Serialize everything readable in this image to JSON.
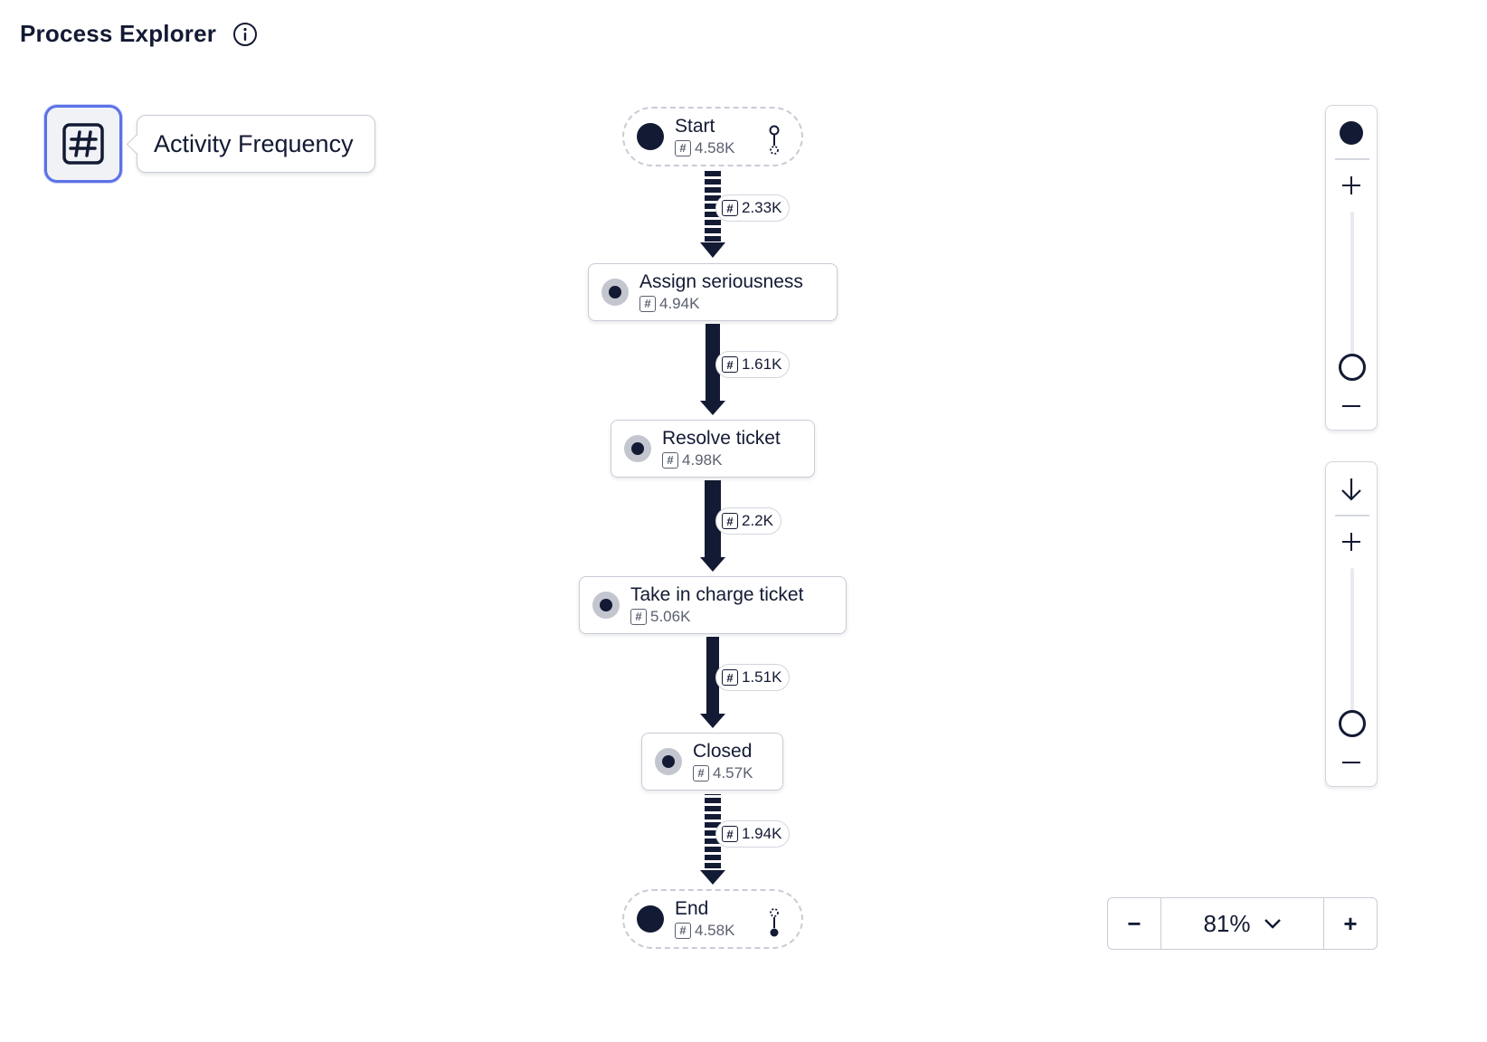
{
  "header": {
    "title": "Process Explorer",
    "info_icon": "info-icon"
  },
  "metric": {
    "icon": "hash-icon",
    "label": "Activity Frequency"
  },
  "nodes": {
    "start": {
      "label": "Start",
      "count": "4.58K"
    },
    "assign": {
      "label": "Assign seriousness",
      "count": "4.94K"
    },
    "resolve": {
      "label": "Resolve ticket",
      "count": "4.98K"
    },
    "take": {
      "label": "Take in charge ticket",
      "count": "5.06K"
    },
    "closed": {
      "label": "Closed",
      "count": "4.57K"
    },
    "end": {
      "label": "End",
      "count": "4.58K"
    }
  },
  "edges": {
    "e1": {
      "count": "2.33K",
      "style": "dashed"
    },
    "e2": {
      "count": "1.61K",
      "style": "solid"
    },
    "e3": {
      "count": "2.2K",
      "style": "solid"
    },
    "e4": {
      "count": "1.51K",
      "style": "solid"
    },
    "e5": {
      "count": "1.94K",
      "style": "dashed"
    }
  },
  "sliders": {
    "activities": {
      "icon": "node-dot-icon",
      "level": 0
    },
    "paths": {
      "icon": "arrow-down-icon",
      "level": 0
    }
  },
  "zoom": {
    "value": "81%",
    "minus": "−",
    "plus": "+"
  },
  "colors": {
    "ink": "#131a33",
    "accent": "#5b72e6",
    "border": "#c9ccd6",
    "muted": "#5b6070"
  }
}
